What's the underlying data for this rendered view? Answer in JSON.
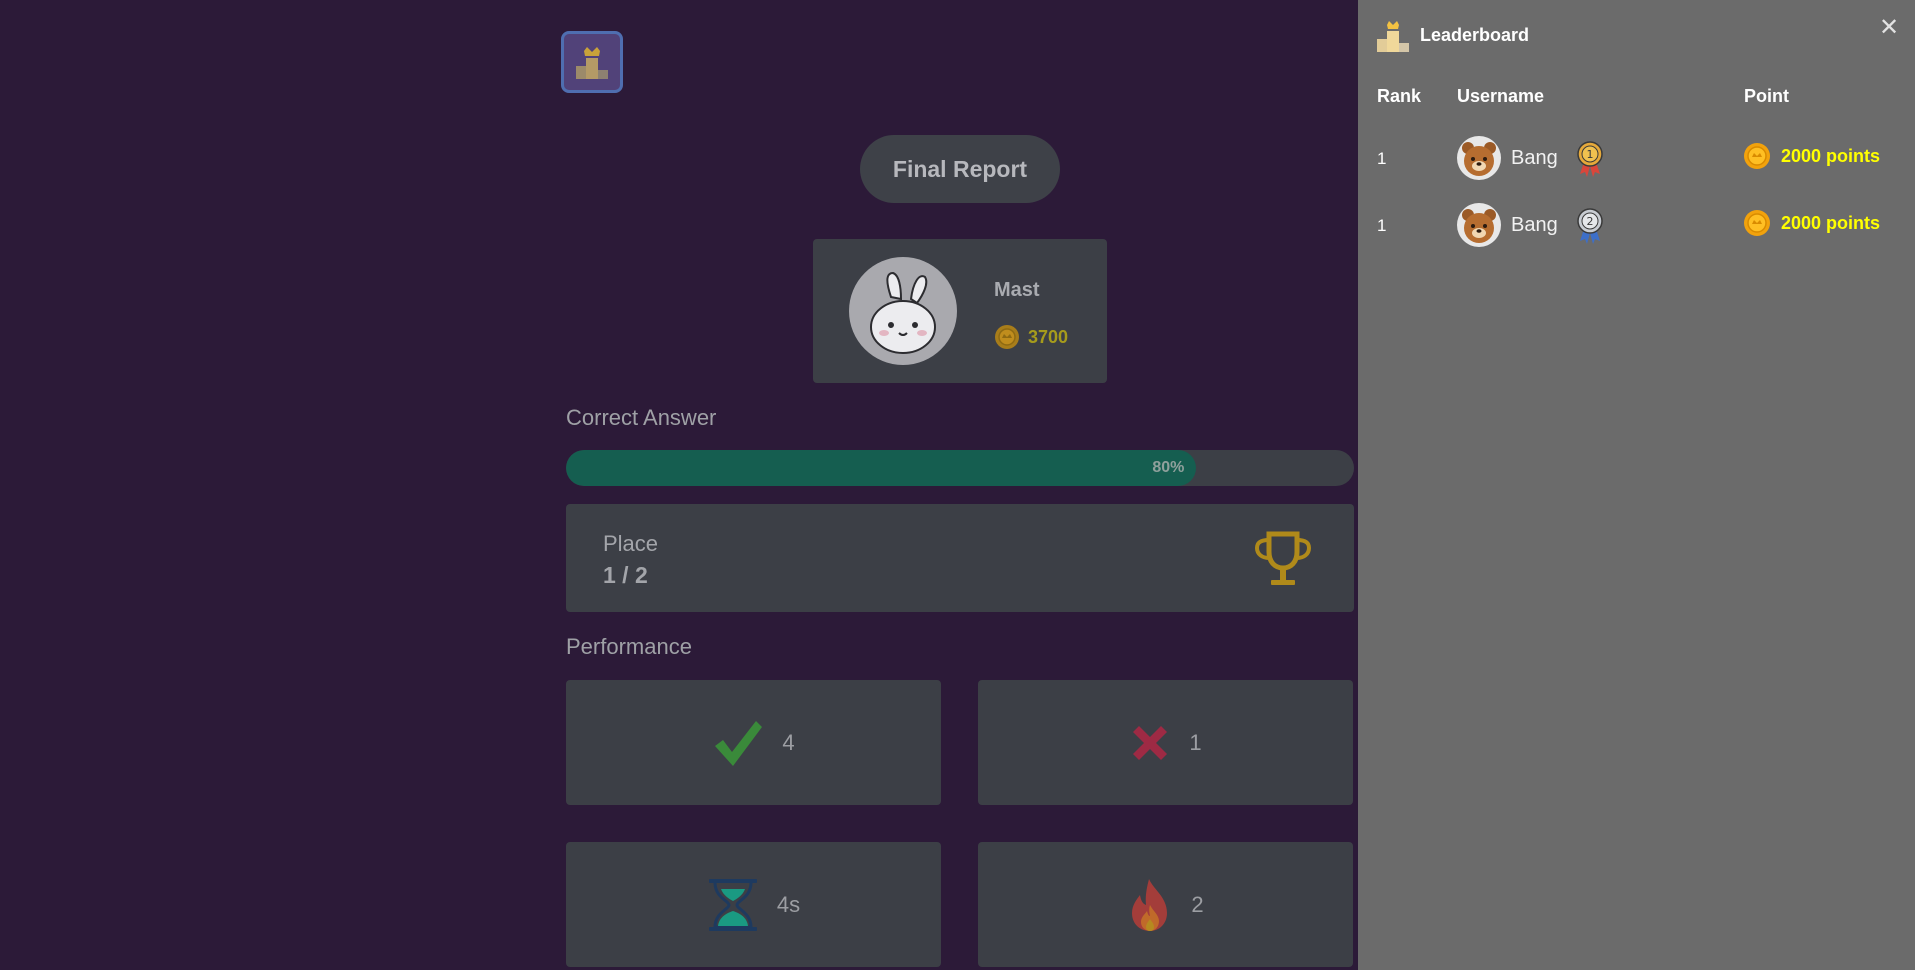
{
  "report": {
    "title": "Final Report",
    "player": {
      "name": "Mast",
      "coins": "3700"
    },
    "correct_answer_label": "Correct Answer",
    "progress": {
      "percent": 80,
      "label": "80%"
    },
    "place": {
      "label": "Place",
      "value": "1 / 2"
    },
    "performance_label": "Performance",
    "stats": {
      "correct": "4",
      "wrong": "1",
      "time": "4s",
      "streak": "2"
    }
  },
  "leaderboard": {
    "title": "Leaderboard",
    "columns": {
      "rank": "Rank",
      "username": "Username",
      "point": "Point"
    },
    "rows": [
      {
        "rank": "1",
        "username": "Bang",
        "medal": "gold-medal-icon",
        "points": "2000 points"
      },
      {
        "rank": "1",
        "username": "Bang",
        "medal": "silver-medal-icon",
        "points": "2000 points"
      }
    ]
  },
  "colors": {
    "background": "#2c1a38",
    "card": "#3c3f46",
    "progress_fill": "#155e50",
    "panel": "#6b6b6b",
    "points": "#ffff00",
    "coin": "#a69b1c"
  },
  "icons": {
    "toggle": "leaderboard-podium-icon",
    "coin": "coin-icon",
    "trophy": "trophy-icon",
    "correct": "checkmark-icon",
    "wrong": "cross-icon",
    "time": "hourglass-icon",
    "streak": "fire-icon",
    "close": "close-icon"
  }
}
